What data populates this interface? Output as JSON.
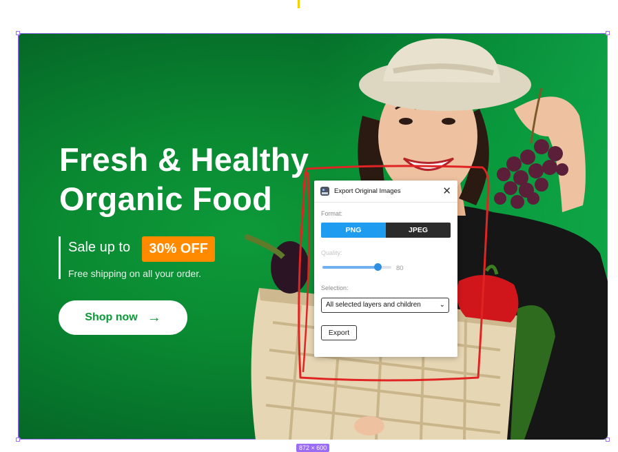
{
  "canvas": {
    "size_label": "872 × 600"
  },
  "hero": {
    "headline_line1": "Fresh & Healthy",
    "headline_line2": "Organic Food",
    "sale_text": "Sale up to",
    "sale_badge": "30% OFF",
    "shipping": "Free shipping on all your order.",
    "shop_button": "Shop now",
    "shop_arrow": "→"
  },
  "dialog": {
    "title": "Export Original Images",
    "close": "✕",
    "format_label": "Format:",
    "formats": [
      "PNG",
      "JPEG"
    ],
    "selected_format": "PNG",
    "quality_label": "Quality:",
    "quality_value": "80",
    "quality_fraction": 0.8,
    "selection_label": "Selection:",
    "selection_value": "All selected layers and children",
    "export_button": "Export"
  },
  "colors": {
    "hero_green": "#0a8a32",
    "badge_orange": "#ff8a00",
    "selection_purple": "#9b6cf5",
    "annotation_red": "#e02424",
    "format_active": "#1e9cf0"
  }
}
